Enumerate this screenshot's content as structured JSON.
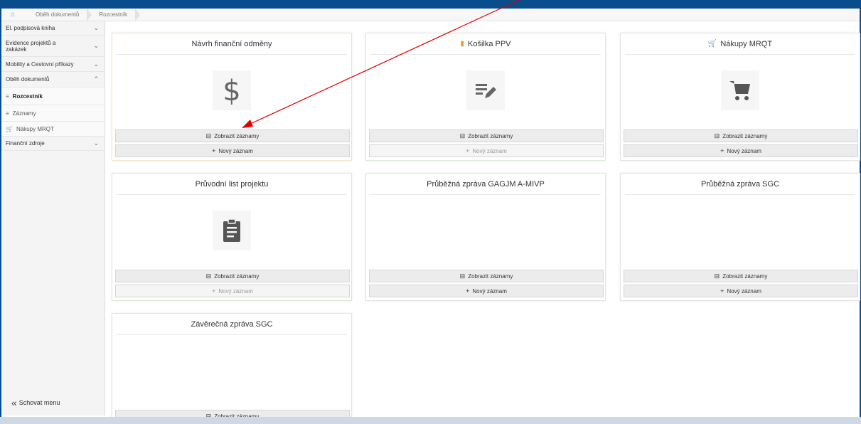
{
  "breadcrumb": {
    "home_icon": "home-icon",
    "items": [
      "Oběh dokumentů",
      "Rozcestník"
    ]
  },
  "sidebar": {
    "items": [
      {
        "label": "El. podpisová kniha",
        "chevron": "⌄"
      },
      {
        "label": "Evidence projektů a zakázek",
        "chevron": "⌄"
      },
      {
        "label": "Mobility a Cestovní příkazy",
        "chevron": "⌄"
      },
      {
        "label": "Oběh dokumentů",
        "chevron": "⌃"
      },
      {
        "label": "Rozcestník",
        "icon": "list-icon"
      },
      {
        "label": "Záznamy",
        "icon": "list-icon"
      },
      {
        "label": "Nákupy MRQT",
        "icon": "cart-icon"
      },
      {
        "label": "Finanční zdroje",
        "chevron": "⌄"
      }
    ],
    "hide_menu": "Schovat menu"
  },
  "cards": [
    {
      "title": "Návrh finanční odměny",
      "icon": "dollar-icon",
      "show": "Zobrazit záznamy",
      "new": "Nový záznam",
      "new_disabled": false
    },
    {
      "title": "Košilka PPV",
      "icon": "edit-lines-icon",
      "show": "Zobrazit záznamy",
      "new": "Nový záznam",
      "new_disabled": true
    },
    {
      "title": "Nákupy MRQT",
      "icon": "cart-icon",
      "show": "Zobrazit záznamy",
      "new": "Nový záznam",
      "new_disabled": false
    },
    {
      "title": "Průvodní list projektu",
      "icon": "clipboard-icon",
      "show": "Zobrazit záznamy",
      "new": "Nový záznam",
      "new_disabled": true
    },
    {
      "title": "Průběžná zpráva GAGJM A-MIVP",
      "show": "Zobrazit záznamy",
      "new": "Nový záznam",
      "new_disabled": false
    },
    {
      "title": "Průběžná zpráva SGC",
      "show": "Zobrazit záznamy",
      "new": "Nový záznam",
      "new_disabled": false
    },
    {
      "title": "Závěrečná zpráva SGC",
      "show": "Zobrazit záznamy"
    }
  ],
  "colors": {
    "frame": "#0a4d8c",
    "annotation_arrow": "#e00000"
  }
}
